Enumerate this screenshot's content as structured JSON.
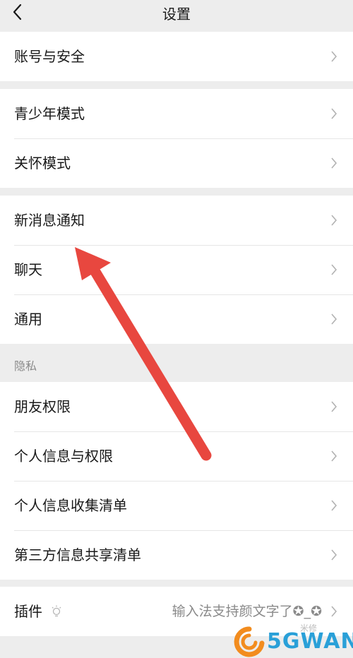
{
  "header": {
    "title": "设置"
  },
  "groups": [
    {
      "items": [
        {
          "label": "账号与安全"
        }
      ]
    },
    {
      "items": [
        {
          "label": "青少年模式"
        },
        {
          "label": "关怀模式"
        }
      ]
    },
    {
      "items": [
        {
          "label": "新消息通知"
        },
        {
          "label": "聊天"
        },
        {
          "label": "通用"
        }
      ]
    },
    {
      "section_label": "隐私",
      "items": [
        {
          "label": "朋友权限"
        },
        {
          "label": "个人信息与权限"
        },
        {
          "label": "个人信息收集清单"
        },
        {
          "label": "第三方信息共享清单"
        }
      ]
    },
    {
      "items": [
        {
          "label": "插件",
          "value": "输入法支持颜文字了✪_✪"
        }
      ]
    }
  ],
  "watermark": {
    "text": "5GWAN",
    "small_text": "米修"
  },
  "colors": {
    "background": "#ededed",
    "row": "#ffffff",
    "arrow": "#e8473f",
    "watermark": "#2aa0d8"
  }
}
